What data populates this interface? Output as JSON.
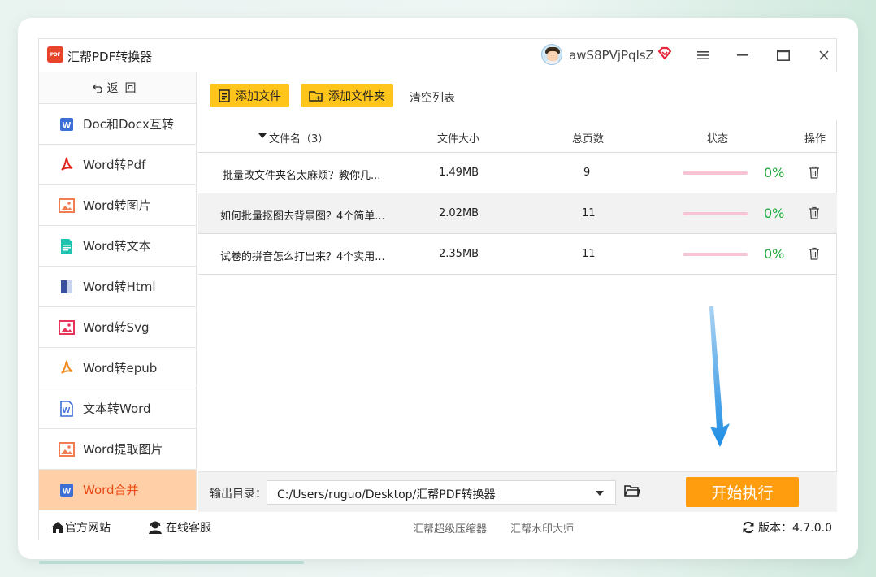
{
  "app": {
    "logo_text": "PDF",
    "title": "汇帮PDF转换器",
    "username": "awS8PVjPqlsZ"
  },
  "window_controls": {
    "menu": "menu-icon",
    "minimize": "minimize-icon",
    "maximize": "maximize-icon",
    "close": "close-icon"
  },
  "sidebar": {
    "back_label": "返回",
    "items": [
      {
        "label": "Doc和Docx互转",
        "icon": "word-icon",
        "color": "#3b6fd6"
      },
      {
        "label": "Word转Pdf",
        "icon": "pdf-icon",
        "color": "#e0261b"
      },
      {
        "label": "Word转图片",
        "icon": "image-icon",
        "color": "#f27d52"
      },
      {
        "label": "Word转文本",
        "icon": "text-icon",
        "color": "#1fc4b0"
      },
      {
        "label": "Word转Html",
        "icon": "html-icon",
        "color": "#3a4fa0"
      },
      {
        "label": "Word转Svg",
        "icon": "svg-icon",
        "color": "#e8345b"
      },
      {
        "label": "Word转epub",
        "icon": "epub-icon",
        "color": "#f08a1a"
      },
      {
        "label": "文本转Word",
        "icon": "word-outline-icon",
        "color": "#3b6fd6"
      },
      {
        "label": "Word提取图片",
        "icon": "extract-image-icon",
        "color": "#f27d52"
      },
      {
        "label": "Word合并",
        "icon": "word-icon",
        "color": "#3b6fd6",
        "active": true
      }
    ]
  },
  "toolbar": {
    "add_file": "添加文件",
    "add_folder": "添加文件夹",
    "clear_list": "清空列表"
  },
  "table": {
    "headers": {
      "name": "文件名（3）",
      "size": "文件大小",
      "pages": "总页数",
      "status": "状态",
      "action": "操作"
    },
    "rows": [
      {
        "name": "批量改文件夹名太麻烦？教你几...",
        "size": "1.49MB",
        "pages": "9",
        "progress": "0%"
      },
      {
        "name": "如何批量抠图去背景图？4个简单...",
        "size": "2.02MB",
        "pages": "11",
        "progress": "0%"
      },
      {
        "name": "试卷的拼音怎么打出来？4个实用...",
        "size": "2.35MB",
        "pages": "11",
        "progress": "0%"
      }
    ]
  },
  "output": {
    "label": "输出目录：",
    "path": "C:/Users/ruguo/Desktop/汇帮PDF转换器",
    "start": "开始执行"
  },
  "statusbar": {
    "website": "官方网站",
    "support": "在线客服",
    "compressor": "汇帮超级压缩器",
    "watermark": "汇帮水印大师",
    "version": "版本：4.7.0.0"
  },
  "colors": {
    "accent_orange": "#ff9d0f",
    "button_yellow": "#ffc51a",
    "active_nav_bg": "#ffd0a8",
    "progress_green": "#1aa83a"
  }
}
